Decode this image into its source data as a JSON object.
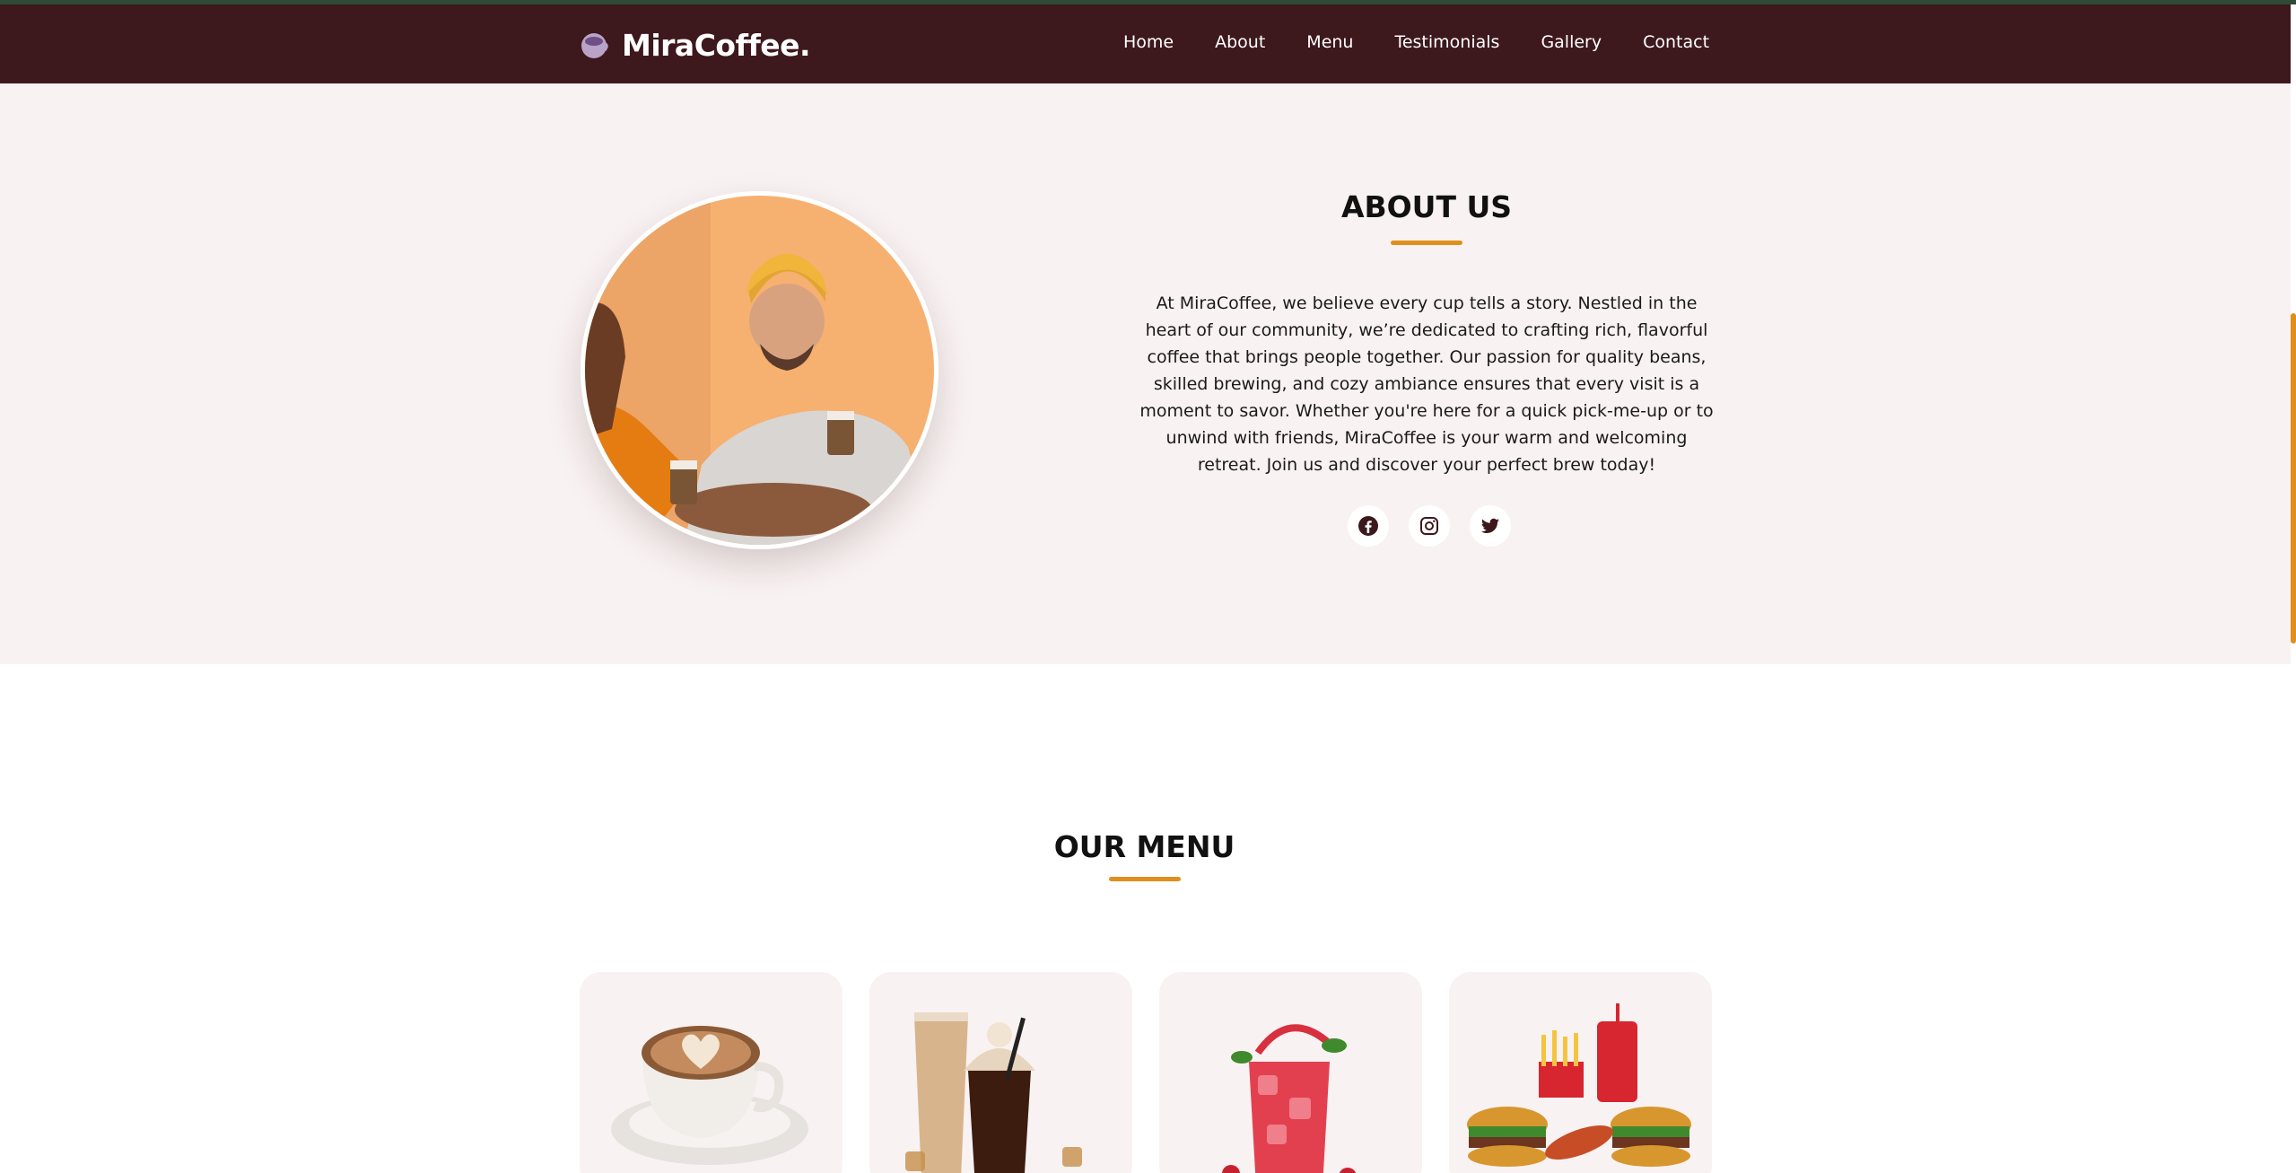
{
  "brand": {
    "name": "MiraCoffee.",
    "icon": "coffee-cup-logo-icon"
  },
  "nav": {
    "items": [
      {
        "label": "Home"
      },
      {
        "label": "About"
      },
      {
        "label": "Menu"
      },
      {
        "label": "Testimonials"
      },
      {
        "label": "Gallery"
      },
      {
        "label": "Contact"
      }
    ]
  },
  "about": {
    "title": "ABOUT US",
    "text": "At MiraCoffee, we believe every cup tells a story. Nestled in the heart of our community, we’re dedicated to crafting rich, flavorful coffee that brings people together. Our passion for quality beans, skilled brewing, and cozy ambiance ensures that every visit is a moment to savor. Whether you're here for a quick pick-me-up or to unwind with friends, MiraCoffee is your warm and welcoming retreat. Join us and discover your perfect brew today!",
    "socials": [
      "facebook-icon",
      "instagram-icon",
      "twitter-icon"
    ]
  },
  "menu": {
    "title": "OUR MENU"
  },
  "colors": {
    "navbar": "#3d181c",
    "accent": "#e08f1c",
    "section_bg": "#f9f2f2"
  }
}
